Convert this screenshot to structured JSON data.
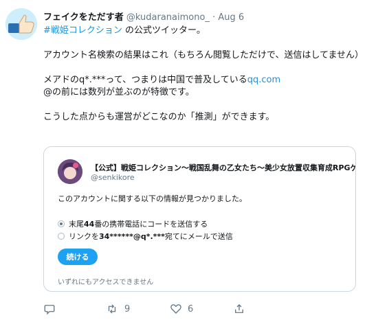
{
  "tweet": {
    "display_name": "フェイクをただす者",
    "handle": "@kudaranaimono_",
    "separator": "·",
    "date": "Aug 6",
    "line1_hashtag": "#戦姫コレクション",
    "line1_rest": " の公式ツイッター。",
    "para2": "アカウント名検索の結果はこれ（もちろん閲覧しただけで、送信はしてません）",
    "para3_line1_prefix": "メアドのq*.***って、つまりは中国で普及している",
    "para3_link": "qq.com",
    "para3_line2": "@の前には数列が並ぶのが特徴です。",
    "para4": "こうした点からも運営がどこなのか「推測」ができます。"
  },
  "card": {
    "title": "【公式】戦姫コレクション〜戦国乱舞の乙女たち〜美少女放置収集育成RPGゲーム",
    "handle": "@senkikore",
    "info": "このアカウントに関する以下の情報が見つかりました。",
    "option1_prefix": "末尾",
    "option1_num": "44",
    "option1_suffix": "番の携帯電話にコードを送信する",
    "option2_prefix": "リンクを",
    "option2_mail": "34******@q*.***",
    "option2_suffix": "宛てにメールで送信",
    "continue_label": "続ける",
    "no_access": "いずれにもアクセスできません"
  },
  "actions": {
    "retweet_count": "9",
    "like_count": "6"
  },
  "colors": {
    "link": "#1b95e0",
    "button": "#1da1f2",
    "secondary_text": "#657786",
    "border": "#ccd6dd"
  }
}
